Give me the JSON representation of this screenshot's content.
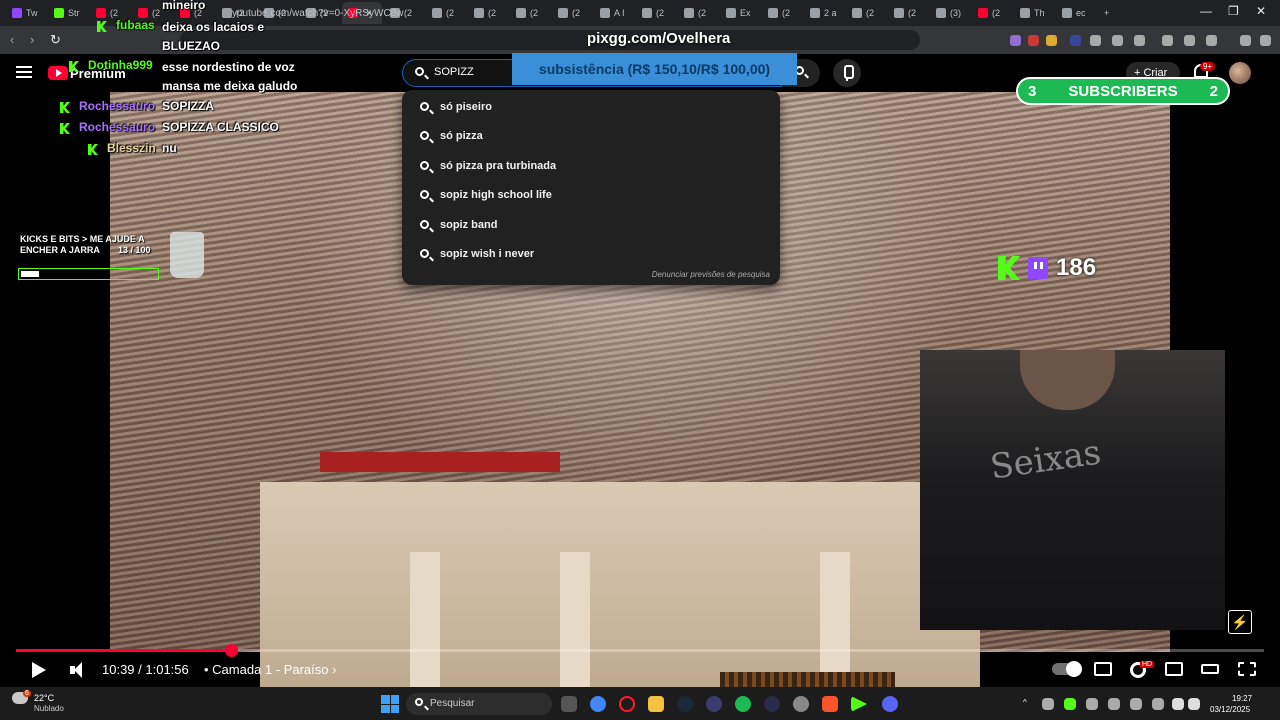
{
  "browser": {
    "tabs": [
      {
        "label": "Tw",
        "fav": "tw"
      },
      {
        "label": "Str",
        "fav": "kk"
      },
      {
        "label": "(2",
        "fav": "yt"
      },
      {
        "label": "(2",
        "fav": "yt"
      },
      {
        "label": "(2",
        "fav": "yt"
      },
      {
        "label": "(2",
        "fav": "gen"
      },
      {
        "label": "(2",
        "fav": "gen"
      },
      {
        "label": "(2",
        "fav": "gen"
      },
      {
        "label": "",
        "fav": "yt",
        "active": true
      },
      {
        "label": "(2",
        "fav": "gen"
      },
      {
        "label": "(2",
        "fav": "gen"
      },
      {
        "label": "(2",
        "fav": "gen"
      },
      {
        "label": "(2",
        "fav": "gen"
      },
      {
        "label": "(2",
        "fav": "gen"
      },
      {
        "label": "A I",
        "fav": "gen"
      },
      {
        "label": "(2",
        "fav": "gen"
      },
      {
        "label": "(2",
        "fav": "gen"
      },
      {
        "label": "Ex",
        "fav": "gen"
      },
      {
        "label": "(2",
        "fav": "gen"
      },
      {
        "label": "2 a",
        "fav": "gen"
      },
      {
        "label": "(2",
        "fav": "gen"
      },
      {
        "label": "(2",
        "fav": "gen"
      },
      {
        "label": "(3)",
        "fav": "gen"
      },
      {
        "label": "(2",
        "fav": "yt"
      },
      {
        "label": "Th",
        "fav": "gen"
      },
      {
        "label": "ec",
        "fav": "gen"
      }
    ],
    "active_tab_close": "×",
    "new_tab": "+",
    "win_minimize": "—",
    "win_restore": "❐",
    "win_close": "✕",
    "url": "youtube.com/watch?v=0-XyRSyWC8w"
  },
  "youtube": {
    "premium_label": "Premium",
    "search_value": "SOPIZZ",
    "suggestions": [
      "só piseiro",
      "só pizza",
      "só pizza pra turbinada",
      "sopiz high school life",
      "sopiz band",
      "sopiz wish i never"
    ],
    "report_label": "Denunciar previsões de pesquisa",
    "create_label": "Criar",
    "notif_count": "9+"
  },
  "overlays": {
    "pix": "pixgg.com/Ovelhera",
    "donation_goal": "subsistência (R$ 150,10/R$ 100,00)",
    "sub_goal_left": "3",
    "sub_goal_label": "SUBSCRIBERS",
    "sub_goal_right": "2",
    "viewer_count": "186",
    "kicks_text": "KICKS E BITS > ME AJUDE A ENCHER A JARRA",
    "kicks_progress": "13  / 100",
    "kicks_fraction": 0.13
  },
  "chat": [
    {
      "user": "",
      "msg": "mineiro",
      "color": "u-green"
    },
    {
      "user": "fubaas",
      "msg": "deixa os lacaios e BLUEZAO",
      "color": "u-green"
    },
    {
      "user": "Dotinha999",
      "msg": "esse nordestino de voz mansa me deixa galudo",
      "color": "u-green"
    },
    {
      "user": "Rochessauro",
      "msg": "SOPIZZA",
      "color": "u-purple"
    },
    {
      "user": "Rochessauro",
      "msg": "SOPIZZA CLASSICO",
      "color": "u-purple"
    },
    {
      "user": "Blesszin",
      "msg": "nu",
      "color": "u-yellow"
    }
  ],
  "player": {
    "current_time": "10:39",
    "duration": "1:01:56",
    "time_display": "10:39 / 1:01:56",
    "chapter": "• Camada 1 - Paraíso ›",
    "played_fraction": 0.172,
    "hd": "HD",
    "bolt": "⚡"
  },
  "scene": {
    "shirt_text": "Seixas"
  },
  "taskbar": {
    "temp": "22°C",
    "weather": "Nublado",
    "weather_badge": "6",
    "search_label": "Pesquisar",
    "time": "19:27",
    "date": "03/12/2025"
  },
  "colors": {
    "accent_red": "#ff0033",
    "kick_green": "#53fc18",
    "twitch_purple": "#9146ff",
    "goal_blue": "#3b8fd9",
    "sub_green": "#1db954"
  }
}
